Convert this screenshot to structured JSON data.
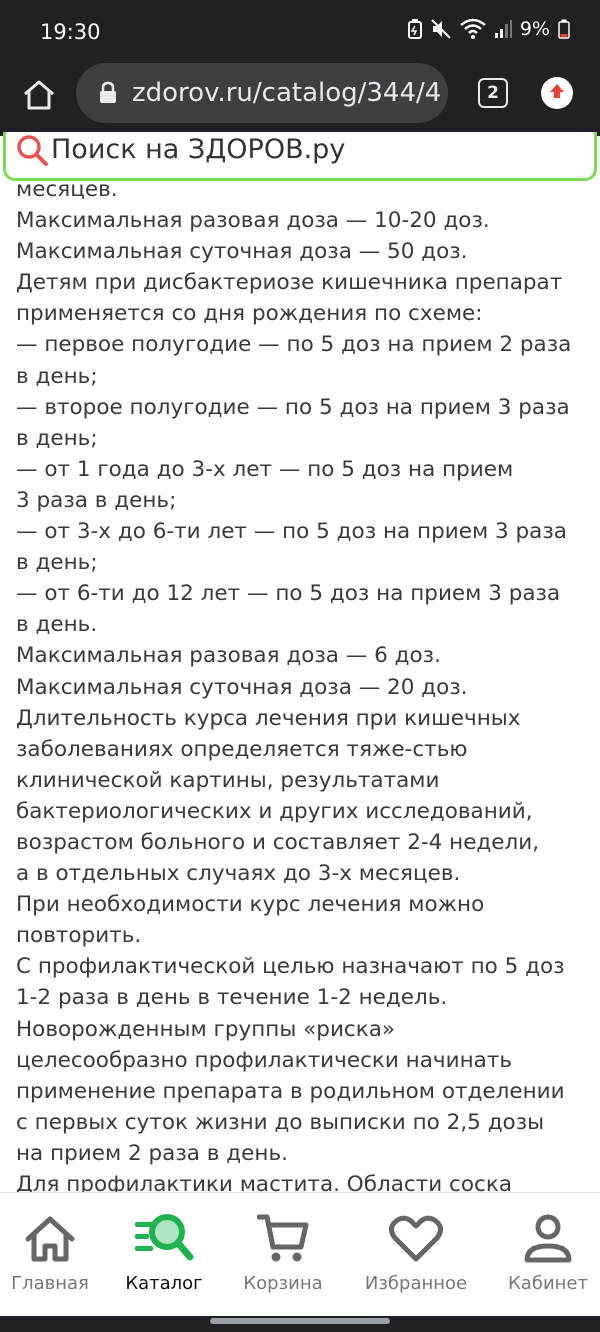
{
  "status_bar": {
    "time": "19:30",
    "battery": "9%",
    "icons": [
      "battery-saver-icon",
      "mute-icon",
      "wifi-icon",
      "signal-icon",
      "battery-icon"
    ]
  },
  "browser": {
    "url": "zdorov.ru/catalog/344/4",
    "tab_count": "2",
    "icons": [
      "home-icon",
      "lock-icon",
      "update-icon"
    ]
  },
  "search": {
    "placeholder": "Поиск на ЗДОРОВ.ру"
  },
  "article": {
    "lines": [
      "месяцев.",
      "Максимальная разовая доза — 10-20 доз.",
      "Максимальная суточная доза — 50 доз.",
      "Детям при дисбактериозе кишечника препарат",
      "применяется со дня рождения по схеме:",
      "— первое полугодие — по 5 доз на прием 2 раза",
      "в день;",
      "— второе полугодие — по 5 доз на прием 3 раза",
      "в день;",
      "— от 1 года до 3-х лет — по 5 доз на прием",
      "3 раза в день;",
      "— от 3-х до 6-ти лет — по 5 доз на прием 3 раза",
      "в день;",
      "— от 6-ти до 12 лет — по 5 доз на прием 3 раза",
      "в день.",
      "Максимальная разовая доза — 6 доз.",
      "Максимальная суточная доза — 20 доз.",
      "Длительность курса лечения при кишечных",
      "заболеваниях определяется тяже-стью",
      "клинической картины, результатами",
      "бактериологических и других исследований,",
      "возрастом больного и составляет 2-4 недели,",
      "а в отдельных случаях до 3-х месяцев.",
      "При необходимости курс лечения можно",
      "повторить.",
      "С профилактической целью назначают по 5 доз",
      "1-2 раза в день в течение 1-2 недель.",
      "Новорожденным группы «риска»",
      "целесообразно профилактически начинать",
      "применение препарата в родильном отделении",
      "с первых суток жизни до выписки по 2,5 дозы",
      "на прием 2 раза в день.",
      "Для профилактики мастита. Области соска"
    ]
  },
  "bottom_nav": {
    "items": [
      {
        "label": "Главная",
        "icon": "home-icon"
      },
      {
        "label": "Каталог",
        "icon": "catalog-search-icon",
        "active": true
      },
      {
        "label": "Корзина",
        "icon": "cart-icon"
      },
      {
        "label": "Избранное",
        "icon": "heart-icon"
      },
      {
        "label": "Кабинет",
        "icon": "user-icon"
      }
    ]
  },
  "colors": {
    "accent_green": "#1db34f",
    "search_border": "#7ed957",
    "search_icon": "#e8554e",
    "system_bar": "#202124",
    "update_red": "#e94235"
  }
}
